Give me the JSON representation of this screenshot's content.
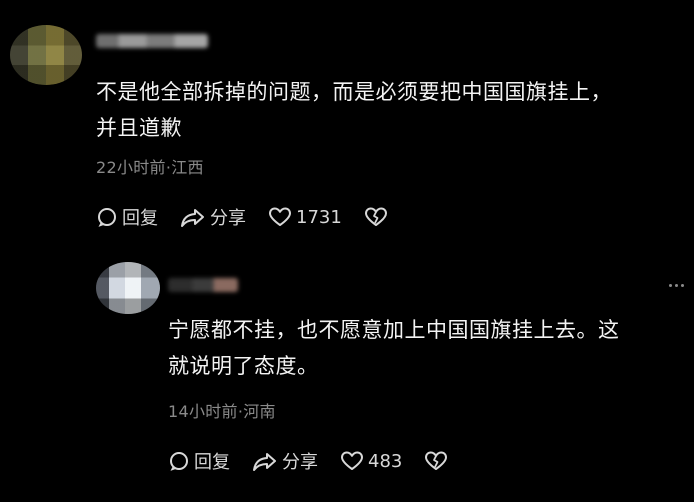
{
  "comments": [
    {
      "text_line1": "不是他全部拆掉的问题，而是必须要把中国国旗挂上，",
      "text_line2": "并且道歉",
      "meta": "22小时前·江西",
      "reply_label": "回复",
      "share_label": "分享",
      "like_count": "1731"
    },
    {
      "text_line1": "宁愿都不挂，也不愿意加上中国国旗挂上去。这",
      "text_line2": "就说明了态度。",
      "meta": "14小时前·河南",
      "reply_label": "回复",
      "share_label": "分享",
      "like_count": "483"
    }
  ],
  "icons": {
    "reply": "comment-bubble-icon",
    "share": "share-arrow-icon",
    "like": "heart-icon",
    "dislike": "broken-heart-icon",
    "more": "more-dots-icon"
  },
  "colors": {
    "background": "#000000",
    "text": "#f4f4f4",
    "meta": "#8a8a8a"
  }
}
